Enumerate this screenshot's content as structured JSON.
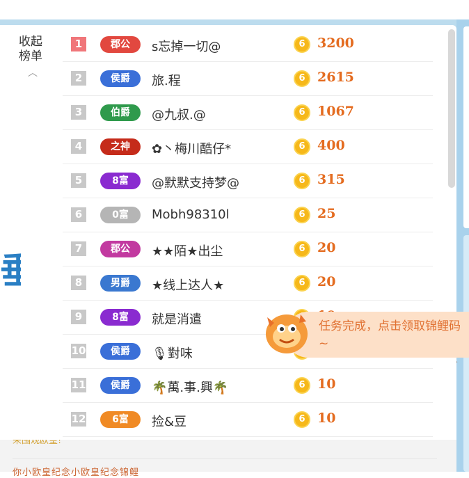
{
  "collapse": {
    "label": "收起榜单",
    "chevron_icon": "chevron-up-icon"
  },
  "leaderboard": [
    {
      "rank": "1",
      "badge": "郡公",
      "badge_color": "#e2483f",
      "name": "s忘掉一切@",
      "coins": "3200",
      "first": true
    },
    {
      "rank": "2",
      "badge": "侯爵",
      "badge_color": "#3a6fd8",
      "name": "旅.程",
      "coins": "2615"
    },
    {
      "rank": "3",
      "badge": "伯爵",
      "badge_color": "#2f9a4c",
      "name": "@九叔.@",
      "coins": "1067"
    },
    {
      "rank": "4",
      "badge": "之神",
      "badge_color": "#c52b1a",
      "name": "✿丶梅川酷仔*",
      "coins": "400"
    },
    {
      "rank": "5",
      "badge": "8富",
      "badge_color": "#8a2bd0",
      "name": "@默默支持梦@",
      "coins": "315"
    },
    {
      "rank": "6",
      "badge": "0富",
      "badge_color": "#b5b5b5",
      "name": "Mobh98310l",
      "coins": "25"
    },
    {
      "rank": "7",
      "badge": "郡公",
      "badge_color": "#c23aa0",
      "name": "★★陌★出尘",
      "coins": "20"
    },
    {
      "rank": "8",
      "badge": "男爵",
      "badge_color": "#3a78d0",
      "name": "★线上达人★",
      "coins": "20"
    },
    {
      "rank": "9",
      "badge": "8富",
      "badge_color": "#8a2bd0",
      "name": "就是消遣",
      "coins": "10"
    },
    {
      "rank": "10",
      "badge": "侯爵",
      "badge_color": "#3a6fd8",
      "name": "🎙對味",
      "coins": "10"
    },
    {
      "rank": "11",
      "badge": "侯爵",
      "badge_color": "#3a6fd8",
      "name": "🌴萬.事.興🌴",
      "coins": "10"
    },
    {
      "rank": "12",
      "badge": "6富",
      "badge_color": "#f08a24",
      "name": "捡&豆",
      "coins": "10"
    }
  ],
  "coin_icon": "coin-icon",
  "coin_symbol": "6",
  "toast": {
    "text": "任务完成，点击领取锦鲤码~"
  },
  "below": {
    "text": "来围观欧皇!",
    "text2": "你小欧皇纪念小欧皇纪念锦鲤"
  },
  "colors": {
    "accent": "#e46c20",
    "rank_first": "#f0767a",
    "rank_default": "#c8c8c8"
  }
}
